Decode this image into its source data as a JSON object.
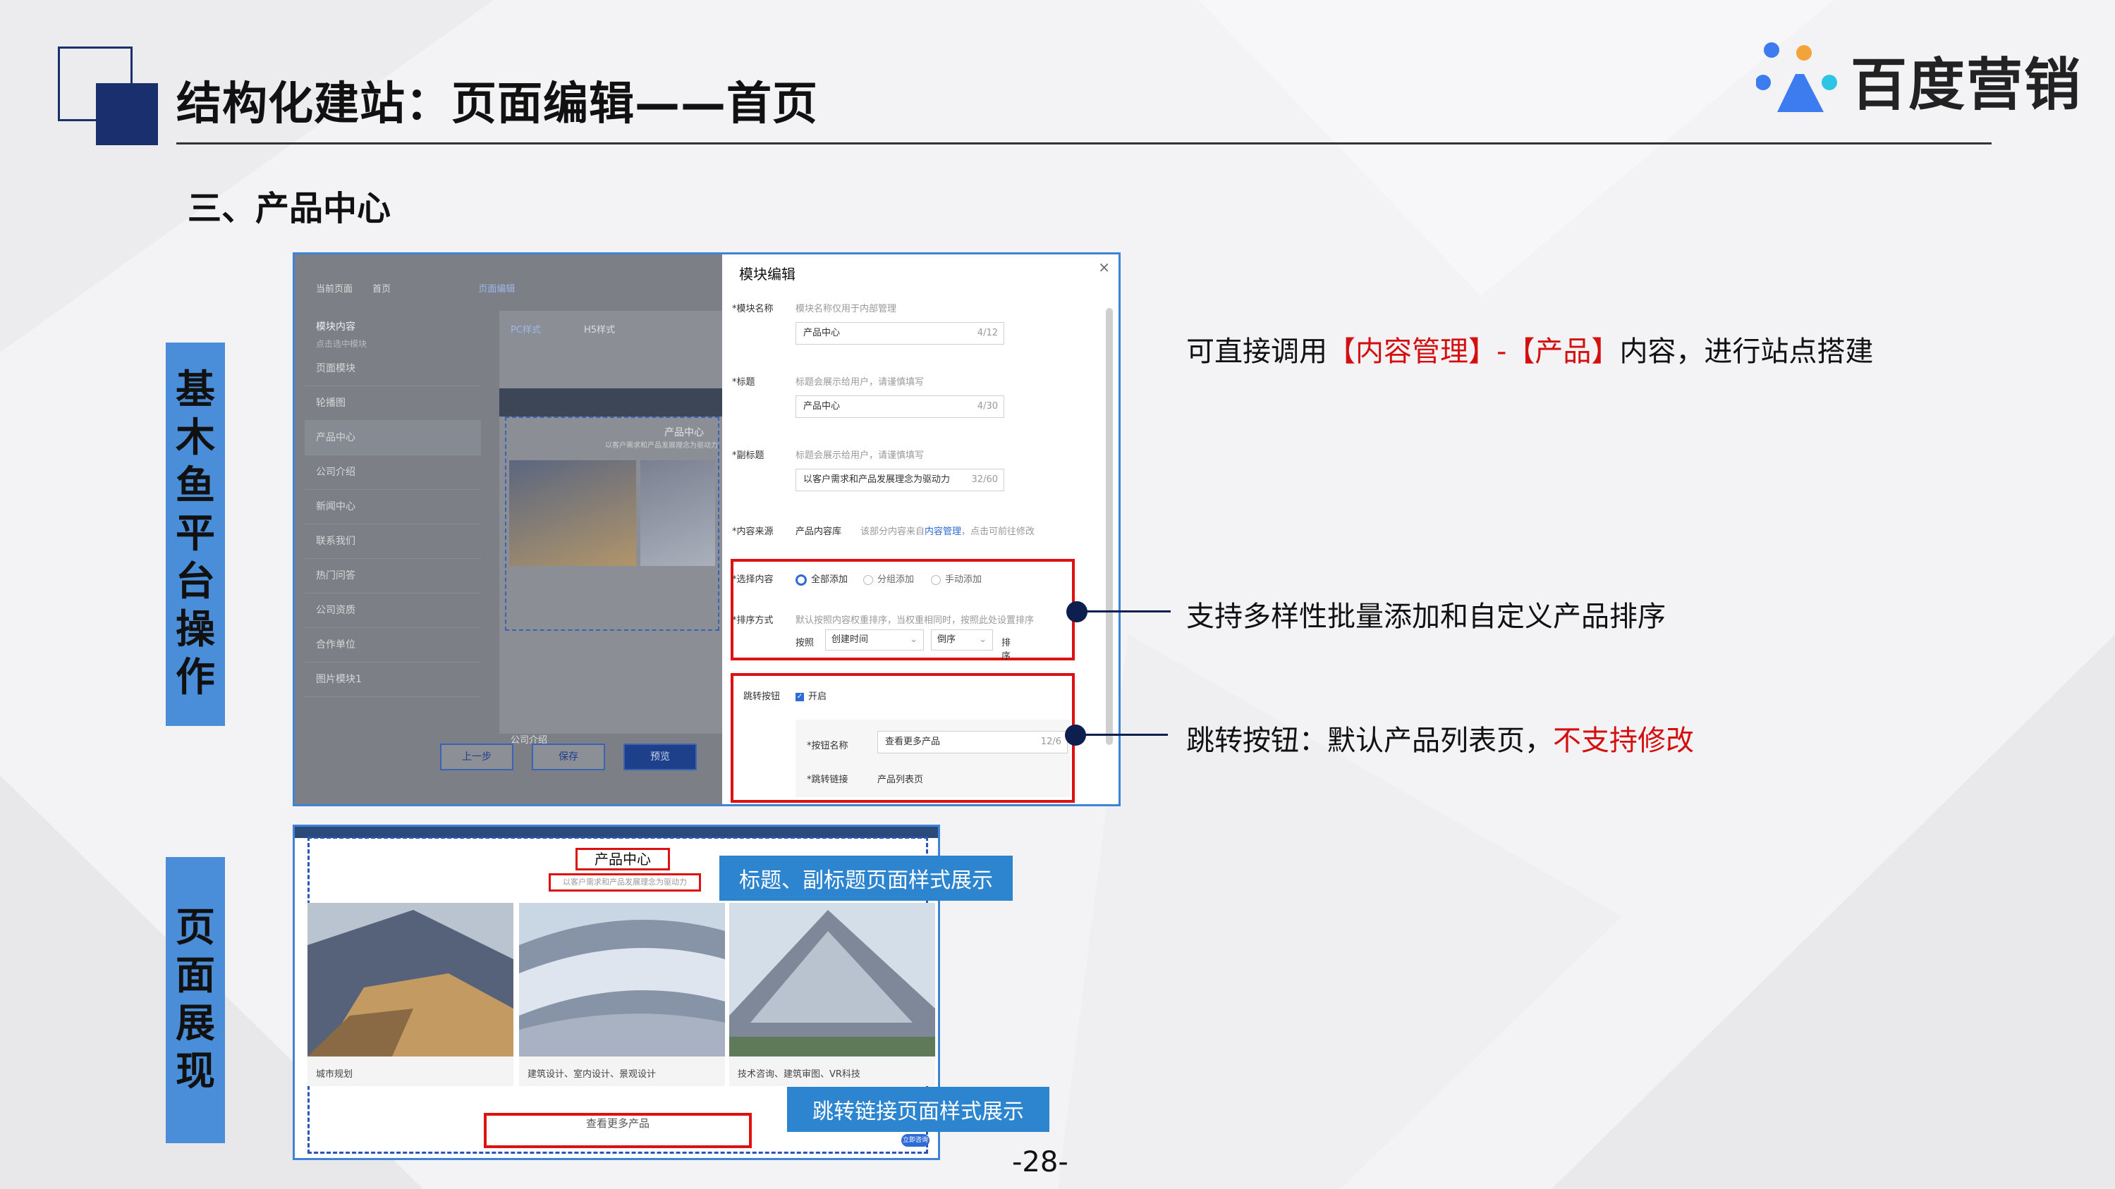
{
  "header": {
    "title": "结构化建站：页面编辑——首页",
    "brand": "百度营销"
  },
  "section_title": "三、产品中心",
  "side_labels": {
    "platform": [
      "基",
      "木",
      "鱼",
      "平",
      "台",
      "操",
      "作"
    ],
    "display": [
      "页",
      "面",
      "展",
      "现"
    ]
  },
  "editor": {
    "left": {
      "top_a": "当前页面",
      "top_b": "首页",
      "top_c": "页面编辑",
      "modules_title": "模块内容",
      "modules_hint": "点击选中模块",
      "modules": [
        "页面模块",
        "轮播图",
        "产品中心",
        "公司介绍",
        "新闻中心",
        "联系我们",
        "热门问答",
        "公司资质",
        "合作单位",
        "图片模块1"
      ],
      "tabs": [
        "PC样式",
        "H5样式"
      ],
      "preview_heading": "产品中心",
      "preview_sub": "以客户需求和产品发展理念为驱动力",
      "preview_company": "公司介绍",
      "buttons": [
        "上一步",
        "保存",
        "预览"
      ]
    },
    "panel": {
      "heading": "模块编辑",
      "close": "×",
      "name_label": "*模块名称",
      "name_hint": "模块名称仅用于内部管理",
      "name_value": "产品中心",
      "name_count": "4/12",
      "title_label": "*标题",
      "title_hint": "标题会展示给用户，请谨慎填写",
      "title_value": "产品中心",
      "title_count": "4/30",
      "sub_label": "*副标题",
      "sub_hint": "标题会展示给用户，请谨慎填写",
      "sub_value": "以客户需求和产品发展理念为驱动力",
      "sub_count": "32/60",
      "source_label": "*内容来源",
      "source_value": "产品内容库",
      "source_hint_a": "该部分内容来自",
      "source_hint_link": "内容管理",
      "source_hint_b": "，点击可前往修改",
      "select_label": "*选择内容",
      "select_options": [
        "全部添加",
        "分组添加",
        "手动添加"
      ],
      "sort_label": "*排序方式",
      "sort_hint": "默认按照内容权重排序，当权重相同时，按照此处设置排序",
      "sort_by": "按照",
      "sort_field": "创建时间",
      "sort_order": "倒序",
      "sort_word": "排序",
      "jump_label": "跳转按钮",
      "jump_toggle": "开启",
      "btn_name_label": "*按钮名称",
      "btn_name_value": "查看更多产品",
      "btn_name_count": "12/6",
      "link_label": "*跳转链接",
      "link_value": "产品列表页"
    }
  },
  "preview": {
    "heading": "产品中心",
    "sub": "以客户需求和产品发展理念为驱动力",
    "cards": [
      "城市规划",
      "建筑设计、室内设计、景观设计",
      "技术咨询、建筑审图、VR科技"
    ],
    "more_button": "查看更多产品",
    "corner": "立即咨询"
  },
  "callouts": {
    "title_style": "标题、副标题页面样式展示",
    "link_style": "跳转链接页面样式展示"
  },
  "notes": {
    "n1_a": "可直接调用",
    "n1_b": "【内容管理】-【产品】",
    "n1_c": "内容，进行站点搭建",
    "n2": "支持多样性批量添加和自定义产品排序",
    "n3_a": "跳转按钮：默认产品列表页，",
    "n3_b": "不支持修改"
  },
  "page_number": "-28-",
  "colors": {
    "navy": "#1a2f6e",
    "label_blue": "#4a8ed9",
    "callout_blue": "#2d84cf",
    "highlight_red": "#d40f0f"
  }
}
